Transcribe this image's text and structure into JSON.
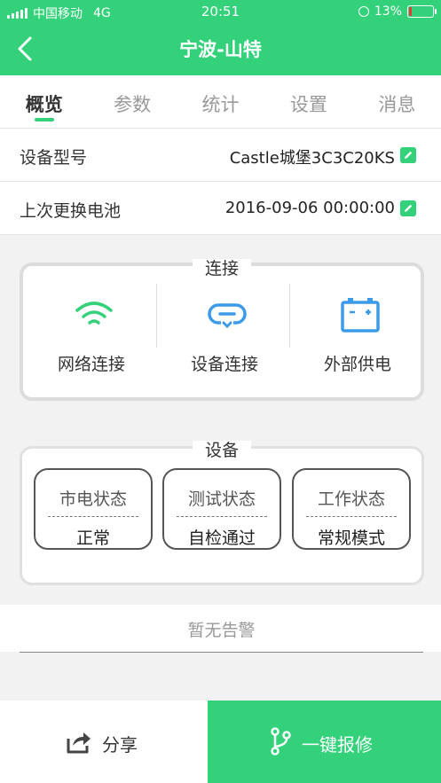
{
  "status_bar": {
    "carrier": "中国移动",
    "network": "4G",
    "time": "20:51",
    "battery": "13%",
    "battery_level": 0.13
  },
  "header": {
    "title": "宁波-山特"
  },
  "tabs": [
    {
      "label": "概览",
      "active": true
    },
    {
      "label": "参数"
    },
    {
      "label": "统计"
    },
    {
      "label": "设置"
    },
    {
      "label": "消息"
    }
  ],
  "info": {
    "model_label": "设备型号",
    "model_value": "Castle城堡3C3C20KS",
    "battery_label": "上次更换电池",
    "battery_value": "2016-09-06 00:00:00"
  },
  "connection": {
    "title": "连接",
    "items": [
      {
        "label": "网络连接",
        "icon": "wifi-icon"
      },
      {
        "label": "设备连接",
        "icon": "link-icon"
      },
      {
        "label": "外部供电",
        "icon": "battery-icon"
      }
    ]
  },
  "device": {
    "title": "设备",
    "items": [
      {
        "title": "市电状态",
        "value": "正常"
      },
      {
        "title": "测试状态",
        "value": "自检通过"
      },
      {
        "title": "工作状态",
        "value": "常规模式"
      }
    ]
  },
  "alarm": {
    "text": "暂无告警"
  },
  "actions": {
    "share": "分享",
    "repair": "一键报修"
  },
  "colors": {
    "brand": "#33d17a",
    "blue": "#3b9be8",
    "battery_low": "#e53935"
  }
}
